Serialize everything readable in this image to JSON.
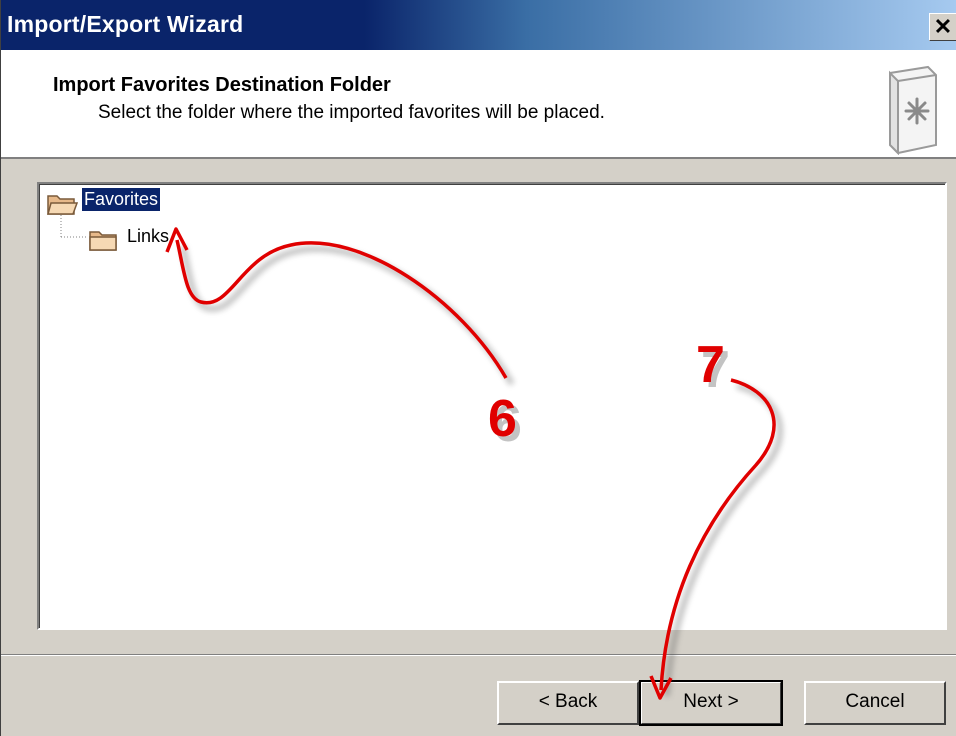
{
  "window": {
    "title": "Import/Export Wizard",
    "close_glyph": "✕"
  },
  "header": {
    "title": "Import Favorites Destination Folder",
    "subtitle": "Select the folder where the imported favorites will be placed.",
    "icon": "wizard-favorites-icon"
  },
  "tree": {
    "items": [
      {
        "label": "Favorites",
        "icon": "folder-open-icon",
        "selected": true
      },
      {
        "label": "Links",
        "icon": "folder-icon",
        "selected": false
      }
    ]
  },
  "buttons": {
    "back": "< Back",
    "next": "Next >",
    "cancel": "Cancel"
  },
  "annotations": {
    "step6": "6",
    "step7": "7",
    "color": "#e00000"
  }
}
